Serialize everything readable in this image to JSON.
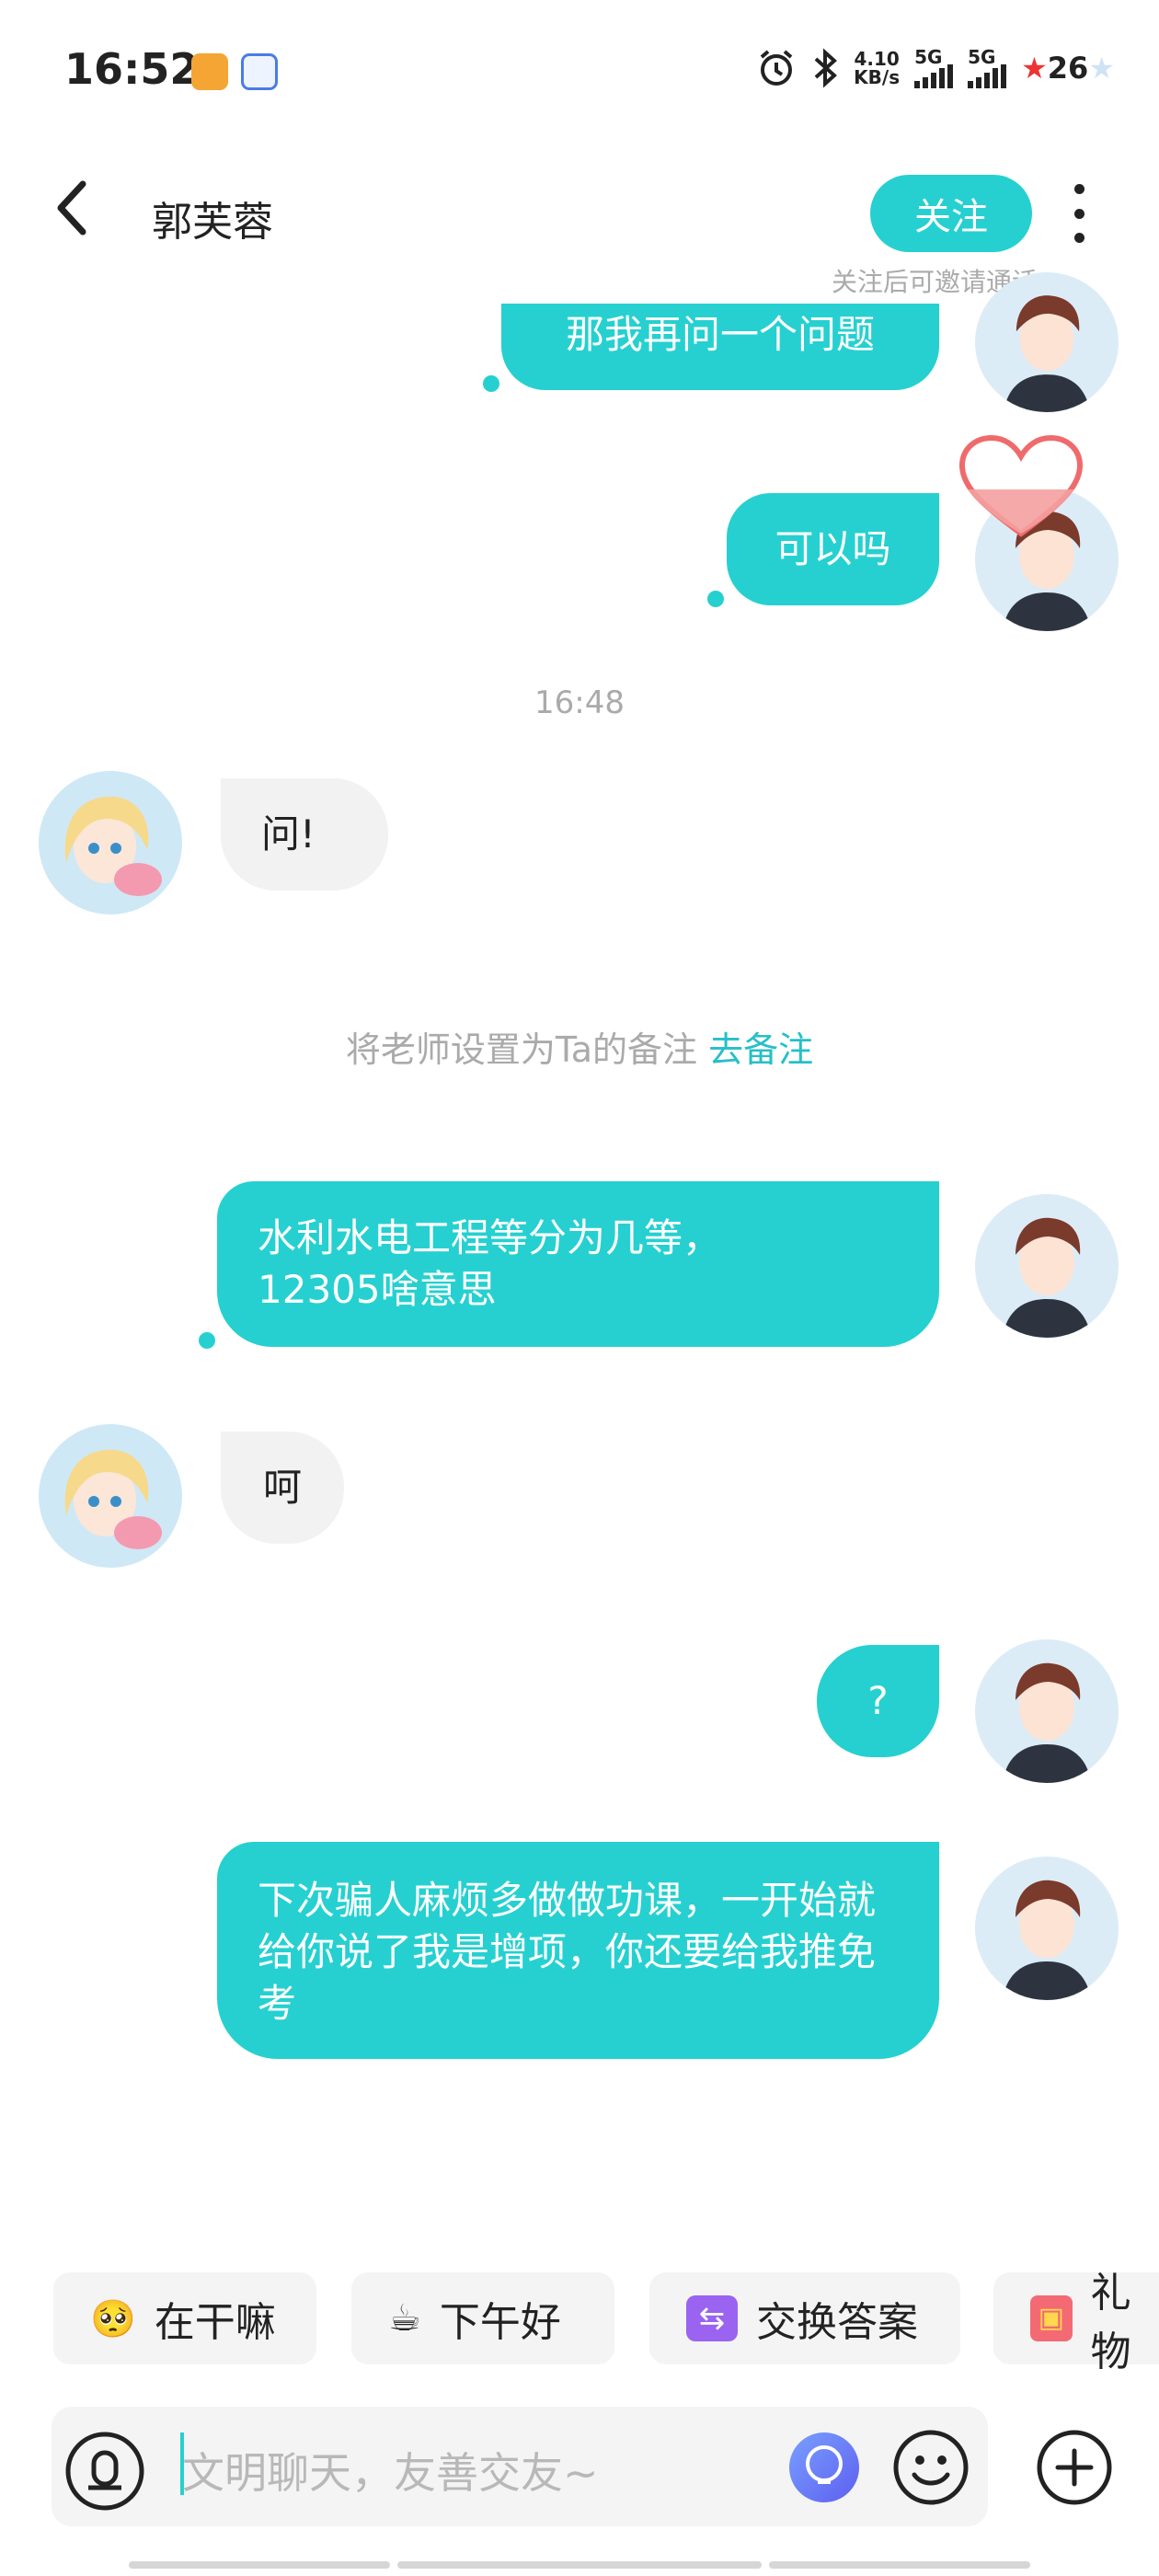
{
  "status_bar": {
    "time": "16:52",
    "net_speed_value": "4.10",
    "net_speed_unit": "KB/s",
    "sim1_label": "5G",
    "sim2_label": "5G",
    "battery": "26"
  },
  "header": {
    "contact_name": "郭芙蓉",
    "follow_label": "关注",
    "follow_hint": "关注后可邀请通话"
  },
  "messages": [
    {
      "side": "out",
      "text": "那我再问一个问题"
    },
    {
      "side": "out",
      "text": "可以吗"
    },
    {
      "side": "time",
      "text": "16:48"
    },
    {
      "side": "in",
      "text": "问!"
    },
    {
      "side": "out",
      "text": "水利水电工程等分为几等，12305啥意思"
    },
    {
      "side": "in",
      "text": "呵"
    },
    {
      "side": "out",
      "text": "?"
    },
    {
      "side": "out",
      "text": "下次骗人麻烦多做做功课，一开始就给你说了我是增项，你还要给我推免考"
    }
  ],
  "system_note": {
    "text": "将老师设置为Ta的备注",
    "link": "去备注"
  },
  "quick_replies": [
    {
      "label": "在干嘛",
      "icon": "face-icon"
    },
    {
      "label": "下午好",
      "icon": "coffee-icon"
    },
    {
      "label": "交换答案",
      "icon": "swap-icon"
    },
    {
      "label": "礼物",
      "icon": "gift-icon"
    }
  ],
  "input": {
    "placeholder": "文明聊天，友善交友~"
  },
  "colors": {
    "accent": "#26d0d0",
    "incoming_bubble": "#f2f2f2"
  }
}
